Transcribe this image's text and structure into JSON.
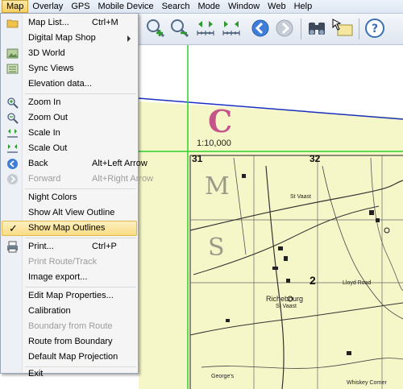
{
  "menubar": {
    "items": [
      "Map",
      "Overlay",
      "GPS",
      "Mobile Device",
      "Search",
      "Mode",
      "Window",
      "Web",
      "Help"
    ]
  },
  "menu": {
    "items": [
      {
        "label": "Map List...",
        "shortcut": "Ctrl+M"
      },
      {
        "label": "Digital Map Shop"
      },
      {
        "label": "3D World"
      },
      {
        "label": "Sync Views"
      },
      {
        "label": "Elevation data..."
      },
      {
        "label": "Zoom In"
      },
      {
        "label": "Zoom Out"
      },
      {
        "label": "Scale In"
      },
      {
        "label": "Scale Out"
      },
      {
        "label": "Back",
        "shortcut": "Alt+Left Arrow"
      },
      {
        "label": "Forward",
        "shortcut": "Alt+Right Arrow"
      },
      {
        "label": "Night Colors"
      },
      {
        "label": "Show Alt View Outline"
      },
      {
        "label": "Show Map Outlines"
      },
      {
        "label": "Print...",
        "shortcut": "Ctrl+P"
      },
      {
        "label": "Print Route/Track"
      },
      {
        "label": "Image export..."
      },
      {
        "label": "Edit Map Properties..."
      },
      {
        "label": "Calibration"
      },
      {
        "label": "Boundary from Route"
      },
      {
        "label": "Route from Boundary"
      },
      {
        "label": "Default Map Projection"
      },
      {
        "label": "Exit"
      }
    ],
    "check_mark": "✓"
  },
  "map": {
    "sheet_letter": "C",
    "scale": "1:10,000",
    "grid_numbers": [
      "31",
      "32",
      "2"
    ],
    "big_letters": [
      "M",
      "S"
    ],
    "place_labels": [
      "St Vaast",
      "Richebourg",
      "St Vaast",
      "Lloyd Road",
      "George's",
      "Whiskey Corner"
    ],
    "colors": {
      "paper": "#f6f7c9",
      "grid_green": "#2fd12f",
      "outline_blue": "#1a2fbf",
      "sheet_letter": "#c4548a"
    }
  }
}
